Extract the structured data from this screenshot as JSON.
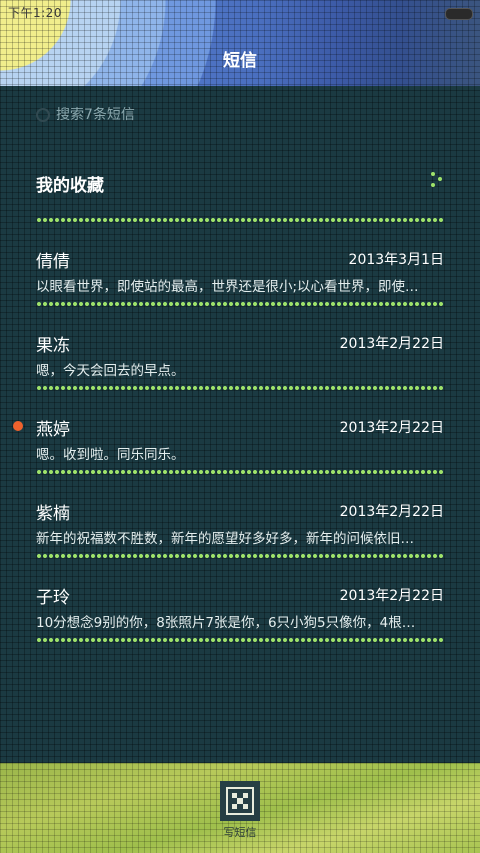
{
  "status_bar": {
    "time": "下午1:20"
  },
  "header": {
    "title": "短信"
  },
  "search": {
    "placeholder": "搜索7条短信"
  },
  "favorites": {
    "label": "我的收藏"
  },
  "messages": [
    {
      "name": "倩倩",
      "date": "2013年3月1日",
      "preview": "以眼看世界，即使站的最高，世界还是很小;以心看世界，即使…",
      "unread": false
    },
    {
      "name": "果冻",
      "date": "2013年2月22日",
      "preview": "嗯，今天会回去的早点。",
      "unread": false
    },
    {
      "name": "燕婷",
      "date": "2013年2月22日",
      "preview": "嗯。收到啦。同乐同乐。",
      "unread": true
    },
    {
      "name": "紫楠",
      "date": "2013年2月22日",
      "preview": "新年的祝福数不胜数，新年的愿望好多好多，新年的问候依旧…",
      "unread": false
    },
    {
      "name": "子玲",
      "date": "2013年2月22日",
      "preview": "10分想念9别的你，8张照片7张是你，6只小狗5只像你，4根…",
      "unread": false
    }
  ],
  "bottom_bar": {
    "compose_label": "写短信"
  },
  "colors": {
    "accent_dots": "#9fe36a",
    "unread": "#f0622d",
    "background": "#1b3a42"
  }
}
